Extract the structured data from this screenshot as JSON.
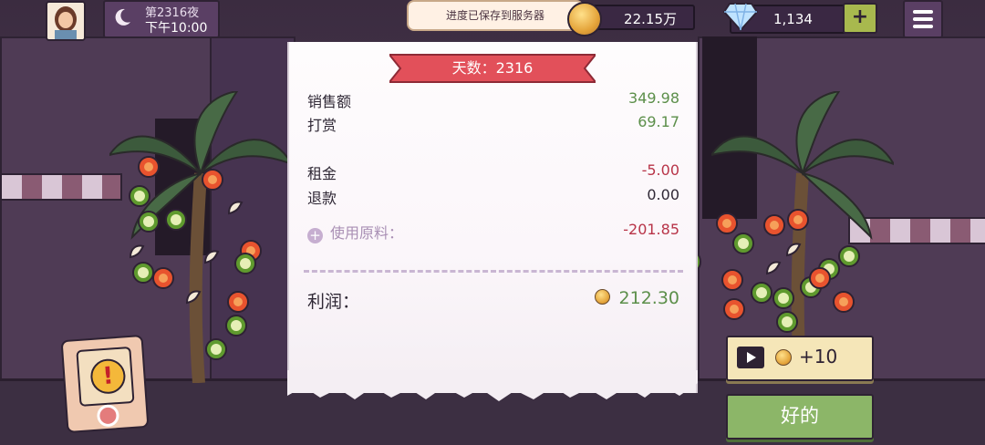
{
  "topbar": {
    "night_label": "第2316夜",
    "time_label": "下午10:00",
    "toast": "进度已保存到服务器",
    "coins": "22.15万",
    "gems": "1,134",
    "add_icon": "plus-icon",
    "menu_icon": "hamburger-icon"
  },
  "receipt": {
    "ribbon": "天数：2316",
    "rows": [
      {
        "label": "销售额",
        "value": "349.98"
      },
      {
        "label": "打赏",
        "value": "69.17"
      },
      {
        "label": "租金",
        "value": "-5.00"
      },
      {
        "label": "退款",
        "value": "0.00"
      },
      {
        "label": "使用原料：",
        "value": "-201.85"
      }
    ],
    "profit_label": "利润：",
    "profit_value": "212.30"
  },
  "buttons": {
    "ad_reward": "+10",
    "ok": "好的"
  },
  "colors": {
    "income": "#5c8f4a",
    "expense": "#b83448",
    "ribbon": "#e2505a",
    "ok_button": "#8cb668",
    "ad_button": "#f5e6b8"
  }
}
